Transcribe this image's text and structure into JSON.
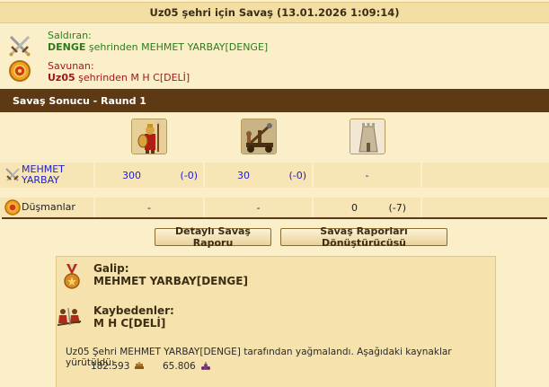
{
  "header": {
    "title": "Uz05 şehri için Savaş (13.01.2026 1:09:14)"
  },
  "attacker": {
    "role_label": "Saldıran:",
    "city": "DENGE",
    "from_text": " şehrinden MEHMET YARBAY[DENGE]",
    "icon": "crossed-swords-icon",
    "color": "#2b7d1c"
  },
  "defender": {
    "role_label": "Savunan:",
    "city": "Uz05",
    "from_text": " şehrinden M H C[DELİ]",
    "icon": "shield-emblem-icon",
    "color": "#a0181b"
  },
  "round": {
    "title": "Savaş Sonucu - Raund 1"
  },
  "units": [
    {
      "icon": "spearman-unit-icon"
    },
    {
      "icon": "catapult-unit-icon"
    },
    {
      "icon": "wall-building-icon"
    }
  ],
  "rows": {
    "attacker": {
      "name": "MEHMET YARBAY",
      "cells": [
        {
          "count": "300",
          "loss": "(-0)"
        },
        {
          "count": "30",
          "loss": "(-0)"
        },
        {
          "count": "-",
          "loss": ""
        }
      ]
    },
    "defender": {
      "name": "Düşmanlar",
      "cells": [
        {
          "count": "-",
          "loss": ""
        },
        {
          "count": "-",
          "loss": ""
        },
        {
          "count": "0",
          "loss": "(-7)"
        }
      ]
    }
  },
  "buttons": {
    "detailed_report": "Detaylı Savaş Raporu",
    "report_converter": "Savaş Raporları Dönüştürücüsü"
  },
  "summary": {
    "winner_label": "Galip:",
    "winner": "MEHMET YARBAY[DENGE]",
    "losers_label": "Kaybedenler:",
    "losers": "M H C[DELİ]",
    "message": "Uz05 Şehri MEHMET YARBAY[DENGE] tarafından yağmalandı. Aşağıdaki kaynaklar yürütüldü:",
    "resources": [
      {
        "amount": "182.593",
        "icon": "wood-resource-icon"
      },
      {
        "amount": "65.806",
        "icon": "wine-resource-icon"
      }
    ]
  },
  "colors": {
    "background": "#fbefc9",
    "section_bar": "#5e3a14",
    "value_blue": "#1f1fcc"
  }
}
